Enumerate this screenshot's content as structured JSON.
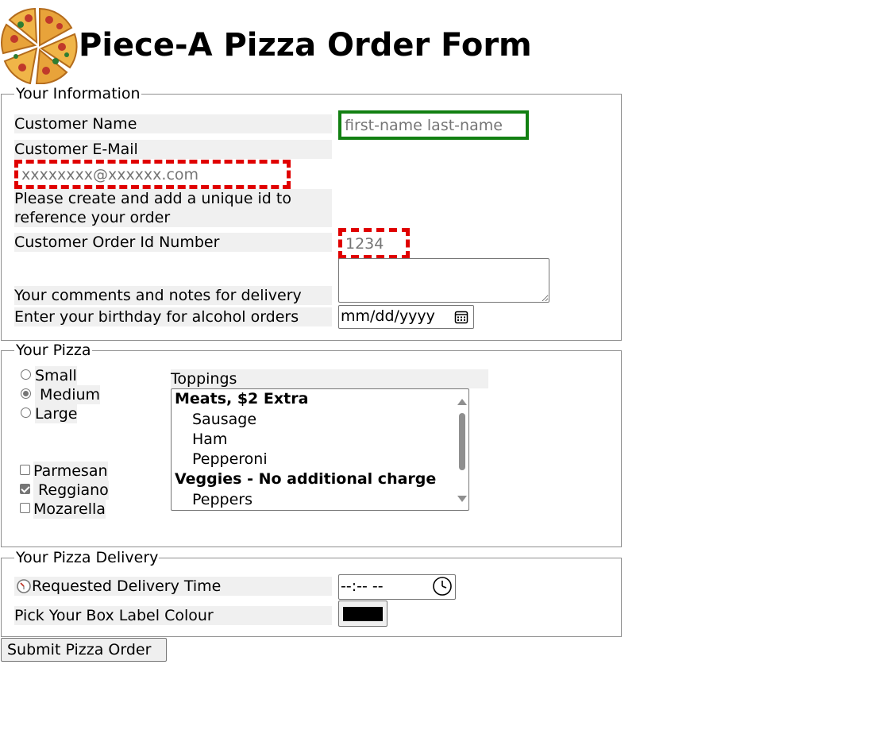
{
  "page_title": "Piece-A Pizza Order Form",
  "logo": "pizza-slices-logo",
  "info_section": {
    "legend": "Your Information",
    "name_label": "Customer Name",
    "name_placeholder": "first-name last-name",
    "email_label": "Customer E-Mail",
    "email_placeholder": "xxxxxxxx@xxxxxx.com",
    "id_prompt": "Please create and add a unique id to reference your order",
    "id_label": "Customer Order Id Number",
    "id_placeholder": "1234",
    "comments_label": "Your comments and notes for delivery",
    "birthday_label": "Enter your birthday for alcohol orders",
    "birthday_value": "mm/dd/yyyy"
  },
  "pizza_section": {
    "legend": "Your Pizza",
    "sizes": [
      {
        "label": "Small",
        "checked": false
      },
      {
        "label": "Medium",
        "checked": true
      },
      {
        "label": "Large",
        "checked": false
      }
    ],
    "cheeses": [
      {
        "label": "Parmesan",
        "checked": false
      },
      {
        "label": "Reggiano",
        "checked": true
      },
      {
        "label": "Mozarella",
        "checked": false
      }
    ],
    "toppings_label": "Toppings",
    "toppings": [
      {
        "type": "group",
        "label": "Meats, $2 Extra"
      },
      {
        "type": "option",
        "label": "Sausage"
      },
      {
        "type": "option",
        "label": "Ham"
      },
      {
        "type": "option",
        "label": "Pepperoni"
      },
      {
        "type": "group",
        "label": "Veggies - No additional charge"
      },
      {
        "type": "option",
        "label": "Peppers"
      }
    ]
  },
  "delivery_section": {
    "legend": "Your Pizza Delivery",
    "time_label": "Requested Delivery Time",
    "time_value": "--:-- --",
    "colour_label": "Pick Your Box Label Colour",
    "colour_value": "#000000"
  },
  "submit_label": "Submit Pizza Order",
  "colors": {
    "name_border": "#128012",
    "dashed_border": "#e00000",
    "label_bg": "#f0f0f0"
  }
}
